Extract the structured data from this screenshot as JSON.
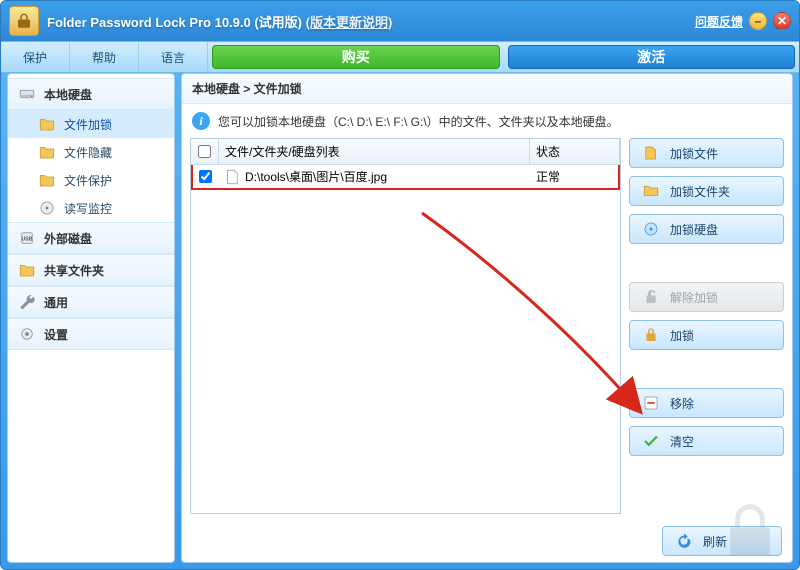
{
  "title": {
    "product": "Folder Password Lock Pro 10.9.0 (试用版)",
    "update_link": "(版本更新说明)",
    "feedback": "问题反馈"
  },
  "menu": {
    "protect": "保护",
    "help": "帮助",
    "language": "语言",
    "buy": "购买",
    "activate": "激活"
  },
  "sidebar": {
    "local_disk": "本地硬盘",
    "items": [
      {
        "label": "文件加锁"
      },
      {
        "label": "文件隐藏"
      },
      {
        "label": "文件保护"
      },
      {
        "label": "读写监控"
      }
    ],
    "external_disk": "外部磁盘",
    "shared_folder": "共享文件夹",
    "general": "通用",
    "settings": "设置"
  },
  "breadcrumb": "本地硬盘 > 文件加锁",
  "info_text": "您可以加锁本地硬盘（C:\\ D:\\ E:\\ F:\\ G:\\）中的文件、文件夹以及本地硬盘。",
  "table": {
    "header_path": "文件/文件夹/硬盘列表",
    "header_status": "状态",
    "rows": [
      {
        "checked": true,
        "path": "D:\\tools\\桌面\\图片\\百度.jpg",
        "status": "正常"
      }
    ]
  },
  "actions": {
    "lock_file": "加锁文件",
    "lock_folder": "加锁文件夹",
    "lock_disk": "加锁硬盘",
    "unlock": "解除加锁",
    "lock": "加锁",
    "remove": "移除",
    "clear": "清空",
    "refresh": "刷新"
  }
}
